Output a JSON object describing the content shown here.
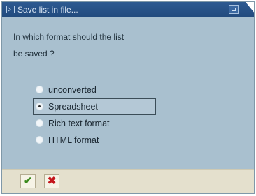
{
  "window": {
    "title": "Save list in file..."
  },
  "question": {
    "line1": "In which format should the list",
    "line2": "be saved ?"
  },
  "options": [
    {
      "label": "unconverted",
      "selected": false
    },
    {
      "label": "Spreadsheet",
      "selected": true
    },
    {
      "label": "Rich text format",
      "selected": false
    },
    {
      "label": "HTML format",
      "selected": false
    }
  ],
  "footer": {
    "ok_icon": "checkmark-icon",
    "cancel_icon": "cross-icon",
    "ok_glyph": "✔",
    "cancel_glyph": "✖"
  },
  "colors": {
    "titlebar": "#2d5a91",
    "body": "#a9c0cf",
    "footer": "#e4e0cd",
    "ok": "#3a8a1c",
    "cancel": "#c4161c"
  }
}
